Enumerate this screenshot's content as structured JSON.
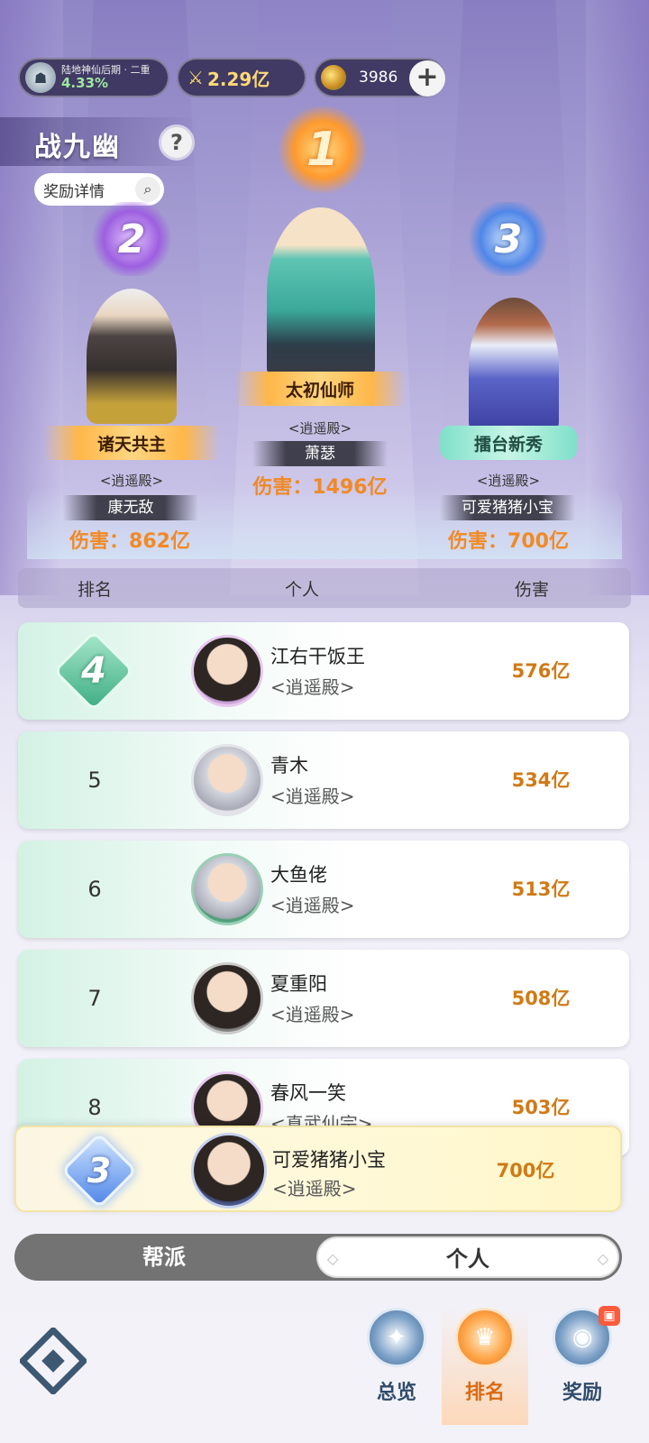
{
  "resources": {
    "realm_name": "陆地神仙后期 · 二重",
    "realm_progress": "4.33%",
    "power": "2.29亿",
    "jade": "3986"
  },
  "header": {
    "title": "战九幽",
    "help": "?",
    "reward_detail": "奖励详情"
  },
  "podium": [
    {
      "rank": "1",
      "title": "太初仙师",
      "guild": "<逍遥殿>",
      "name": "萧瑟",
      "damage": "伤害：1496亿"
    },
    {
      "rank": "2",
      "title": "诸天共主",
      "guild": "<逍遥殿>",
      "name": "康无敌",
      "damage": "伤害：862亿"
    },
    {
      "rank": "3",
      "title": "擂台新秀",
      "guild": "<逍遥殿>",
      "name": "可爱猪猪小宝",
      "damage": "伤害：700亿"
    }
  ],
  "table": {
    "headers": {
      "rank": "排名",
      "person": "个人",
      "damage": "伤害"
    },
    "rows": [
      {
        "rank": "4",
        "name": "江右干饭王",
        "guild": "<逍遥殿>",
        "damage": "576亿"
      },
      {
        "rank": "5",
        "name": "青木",
        "guild": "<逍遥殿>",
        "damage": "534亿"
      },
      {
        "rank": "6",
        "name": "大鱼佬",
        "guild": "<逍遥殿>",
        "damage": "513亿"
      },
      {
        "rank": "7",
        "name": "夏重阳",
        "guild": "<逍遥殿>",
        "damage": "508亿"
      },
      {
        "rank": "8",
        "name": "春风一笑",
        "guild": "<真武仙宗>",
        "damage": "503亿"
      }
    ]
  },
  "my_rank": {
    "rank": "3",
    "name": "可爱猪猪小宝",
    "guild": "<逍遥殿>",
    "damage": "700亿"
  },
  "toggle": {
    "guild": "帮派",
    "personal": "个人",
    "active": "personal"
  },
  "nav": {
    "overview": "总览",
    "ranking": "排名",
    "rewards": "奖励",
    "active": "ranking"
  },
  "colors": {
    "accent": "#f08a26",
    "rank_green": "#3fae84",
    "rank_blue": "#4f86e8"
  }
}
